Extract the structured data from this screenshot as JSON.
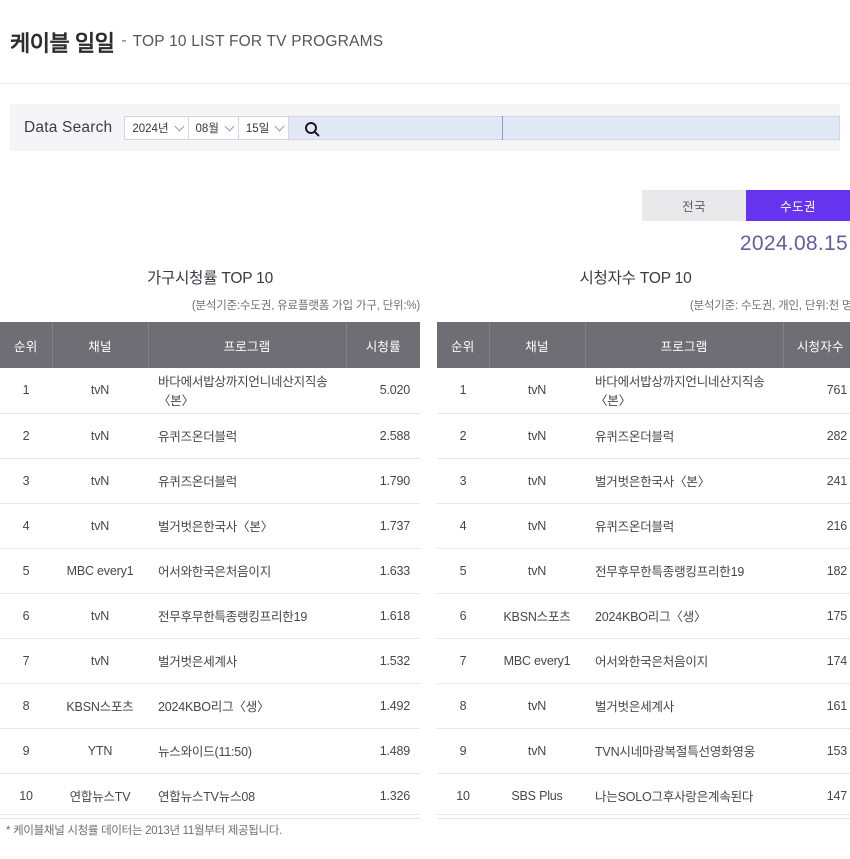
{
  "header": {
    "title_ko": "케이블 일일",
    "dash": "-",
    "title_en": "TOP 10 LIST FOR TV PROGRAMS"
  },
  "search": {
    "label": "Data Search",
    "year": "2024년",
    "month": "08월",
    "day": "15일",
    "icon": "search-icon",
    "query_value": "",
    "placeholder": ""
  },
  "region": {
    "tabs": [
      {
        "label": "전국",
        "active": false
      },
      {
        "label": "수도권",
        "active": true
      }
    ],
    "active_color": "#6633ee",
    "inactive_color": "#e9e9ec"
  },
  "date_display": "2024.08.15",
  "accent_color": "#6633ee",
  "value_color": "#7b5fc4",
  "footnote": "* 케이블채널 시청률 데이터는 2013년 11월부터 제공됩니다.",
  "tables": {
    "left": {
      "title": "가구시청률 TOP 10",
      "subtitle": "(분석기준:수도권, 유료플랫폼 가입 가구, 단위:%)",
      "columns": [
        "순위",
        "채널",
        "프로그램",
        "시청률"
      ],
      "rows": [
        {
          "rank": "1",
          "channel": "tvN",
          "program": "바다에서밥상까지언니네산지직송〈본〉",
          "value": "5.020"
        },
        {
          "rank": "2",
          "channel": "tvN",
          "program": "유퀴즈온더블럭",
          "value": "2.588"
        },
        {
          "rank": "3",
          "channel": "tvN",
          "program": "유퀴즈온더블럭",
          "value": "1.790"
        },
        {
          "rank": "4",
          "channel": "tvN",
          "program": "벌거벗은한국사〈본〉",
          "value": "1.737"
        },
        {
          "rank": "5",
          "channel": "MBC every1",
          "program": "어서와한국은처음이지",
          "value": "1.633"
        },
        {
          "rank": "6",
          "channel": "tvN",
          "program": "전무후무한특종랭킹프리한19",
          "value": "1.618"
        },
        {
          "rank": "7",
          "channel": "tvN",
          "program": "벌거벗은세계사",
          "value": "1.532"
        },
        {
          "rank": "8",
          "channel": "KBSN스포츠",
          "program": "2024KBO리그〈생〉",
          "value": "1.492"
        },
        {
          "rank": "9",
          "channel": "YTN",
          "program": "뉴스와이드(11:50)",
          "value": "1.489"
        },
        {
          "rank": "10",
          "channel": "연합뉴스TV",
          "program": "연합뉴스TV뉴스08",
          "value": "1.326"
        }
      ]
    },
    "right": {
      "title": "시청자수 TOP 10",
      "subtitle": "(분석기준: 수도권, 개인, 단위:천 명)",
      "columns": [
        "순위",
        "채널",
        "프로그램",
        "시청자수"
      ],
      "rows": [
        {
          "rank": "1",
          "channel": "tvN",
          "program": "바다에서밥상까지언니네산지직송〈본〉",
          "value": "761"
        },
        {
          "rank": "2",
          "channel": "tvN",
          "program": "유퀴즈온더블럭",
          "value": "282"
        },
        {
          "rank": "3",
          "channel": "tvN",
          "program": "벌거벗은한국사〈본〉",
          "value": "241"
        },
        {
          "rank": "4",
          "channel": "tvN",
          "program": "유퀴즈온더블럭",
          "value": "216"
        },
        {
          "rank": "5",
          "channel": "tvN",
          "program": "전무후무한특종랭킹프리한19",
          "value": "182"
        },
        {
          "rank": "6",
          "channel": "KBSN스포츠",
          "program": "2024KBO리그〈생〉",
          "value": "175"
        },
        {
          "rank": "7",
          "channel": "MBC every1",
          "program": "어서와한국은처음이지",
          "value": "174"
        },
        {
          "rank": "8",
          "channel": "tvN",
          "program": "벌거벗은세계사",
          "value": "161"
        },
        {
          "rank": "9",
          "channel": "tvN",
          "program": "TVN시네마광복절특선영화영웅",
          "value": "153"
        },
        {
          "rank": "10",
          "channel": "SBS Plus",
          "program": "나는SOLO그후사랑은계속된다",
          "value": "147"
        }
      ]
    }
  }
}
